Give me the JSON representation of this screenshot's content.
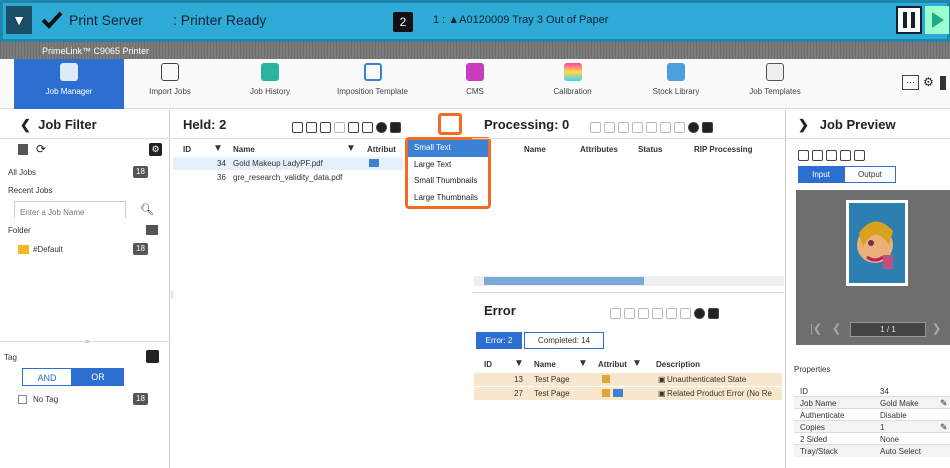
{
  "titlebar": {
    "app_name": "Print Server",
    "status": ": Printer Ready",
    "queue_count": "2",
    "alert": "1 : ▲A0120009 Tray 3 Out of Paper"
  },
  "subbar": {
    "printer_name": "PrimeLink™ C9065 Printer"
  },
  "toolbar": {
    "items": [
      "Job Manager",
      "Import Jobs",
      "Job History",
      "Imposition Template",
      "CMS",
      "Calibration",
      "Stock Library",
      "Job Templates"
    ]
  },
  "job_filter": {
    "title": "Job Filter",
    "all_jobs": "All Jobs",
    "all_jobs_count": "18",
    "recent_jobs": "Recent Jobs",
    "search_placeholder": "Enter a Job Name",
    "folder": "Folder",
    "default_folder": "#Default",
    "default_count": "18",
    "tag": "Tag",
    "and": "AND",
    "or": "OR",
    "no_tag": "No Tag",
    "no_tag_count": "18"
  },
  "held": {
    "title": "Held: 2",
    "col_id": "ID",
    "col_name": "Name",
    "col_attr": "Attribut",
    "rows": [
      {
        "id": "34",
        "name": "Gold Makeup LadyPF.pdf"
      },
      {
        "id": "36",
        "name": "gre_research_validity_data.pdf"
      }
    ]
  },
  "view_menu": {
    "items": [
      "Small Text",
      "Large Text",
      "Small Thumbnails",
      "Large Thumbnails"
    ]
  },
  "processing": {
    "title": "Processing: 0",
    "cols": [
      "Name",
      "Attributes",
      "Status",
      "RIP Processing"
    ]
  },
  "error": {
    "title": "Error",
    "tab_error": "Error: 2",
    "tab_completed": "Completed: 14",
    "cols": [
      "ID",
      "Name",
      "Attribut",
      "Description"
    ],
    "rows": [
      {
        "id": "13",
        "name": "Test Page",
        "desc": "Unauthenticated State"
      },
      {
        "id": "27",
        "name": "Test Page",
        "desc": "Related Product Error (No Re"
      }
    ]
  },
  "preview": {
    "title": "Job Preview",
    "tab_input": "Input",
    "tab_output": "Output",
    "page": "1 / 1",
    "properties": "Properties",
    "rows": [
      [
        "ID",
        "34"
      ],
      [
        "Job Name",
        "Gold Make"
      ],
      [
        "Authenticate",
        "Disable"
      ],
      [
        "Copies",
        "1"
      ],
      [
        "2 Sided",
        "None"
      ],
      [
        "Tray/Stack",
        "Auto Select"
      ]
    ]
  }
}
